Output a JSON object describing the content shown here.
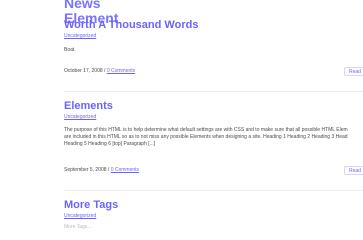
{
  "posts": [
    {
      "title_partial": "News",
      "title_overlap": "Element",
      "title_main": "Worth A Thousand Words",
      "category": "Uncategorized",
      "excerpt": "Boat.",
      "date": "October 17, 2008",
      "separator": " / ",
      "comments": "0 Comments",
      "read_more": "Read"
    },
    {
      "title_main": "Elements",
      "category": "Uncategorized",
      "excerpt_line1": "The purpose of this HTML is to help determine what default settings are with CSS and to make sure that all possible HTML Elem",
      "excerpt_line2": "are included in this HTML so as to not miss any possible Elements when designing a site. Heading 1 Heading 2 Heading 3 Head",
      "excerpt_line3": "Heading 5 Heading 6 [top] Paragraph [...]",
      "date": "September 5, 2008",
      "separator": " / ",
      "comments": "0 Comments",
      "read_more": "Read"
    },
    {
      "title_main": "More Tags",
      "category": "Uncategorized",
      "excerpt": "More Tags..."
    }
  ]
}
